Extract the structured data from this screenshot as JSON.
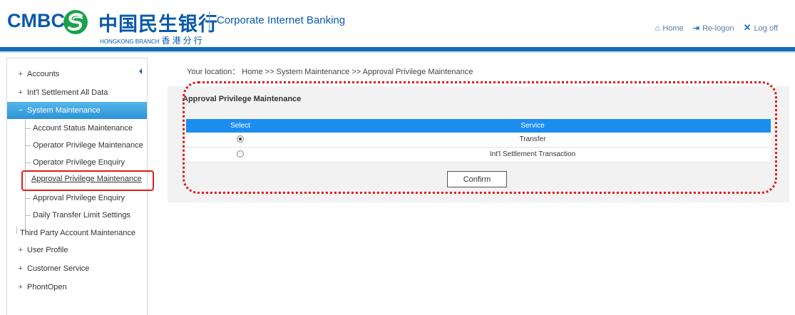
{
  "header": {
    "logo_text": "CMBC",
    "logo_cn": "中国民生银行",
    "branch_en": "HONGKONG BRANCH",
    "branch_cn": "香港分行",
    "title": "Corporate Internet Banking",
    "links": [
      {
        "icon": "home-icon",
        "label": "Home"
      },
      {
        "icon": "relogon-icon",
        "label": "Re-logon"
      },
      {
        "icon": "close-icon",
        "label": "Log off"
      }
    ]
  },
  "sidebar": {
    "items": [
      {
        "prefix": "+",
        "label": "Accounts"
      },
      {
        "prefix": "+",
        "label": "Int'l Settlement All Data"
      },
      {
        "prefix": "−",
        "label": "System Maintenance",
        "active": true
      },
      {
        "prefix": "+",
        "label": "User Profile"
      },
      {
        "prefix": "+",
        "label": "Customer Service"
      },
      {
        "prefix": "+",
        "label": "PhontOpen"
      }
    ],
    "sub_items": [
      "Account Status Maintenance",
      "Operator Privilege Maintenance",
      "Operator Privilege Enquiry",
      "Approval Privilege Maintenance",
      "Approval Privilege Enquiry",
      "Daily Transfer Limit Settings",
      "Third Party Account Maintenance"
    ]
  },
  "main": {
    "breadcrumb": "Your location： Home >> System Maintenance >> Approval Privilege Maintenance",
    "panel_title": "Approval Privilege Maintenance",
    "table": {
      "columns": [
        "Select",
        "Service"
      ],
      "rows": [
        {
          "selected": true,
          "service": "Transfer"
        },
        {
          "selected": false,
          "service": "Int'l Settlement Transaction"
        }
      ]
    },
    "confirm_label": "Confirm"
  },
  "colors": {
    "brand_blue": "#0a5aa8",
    "bar_blue": "#0f6dbd",
    "table_header": "#1c8ef0",
    "active_menu": "#2c93d6",
    "highlight_red": "#e01b1b"
  }
}
